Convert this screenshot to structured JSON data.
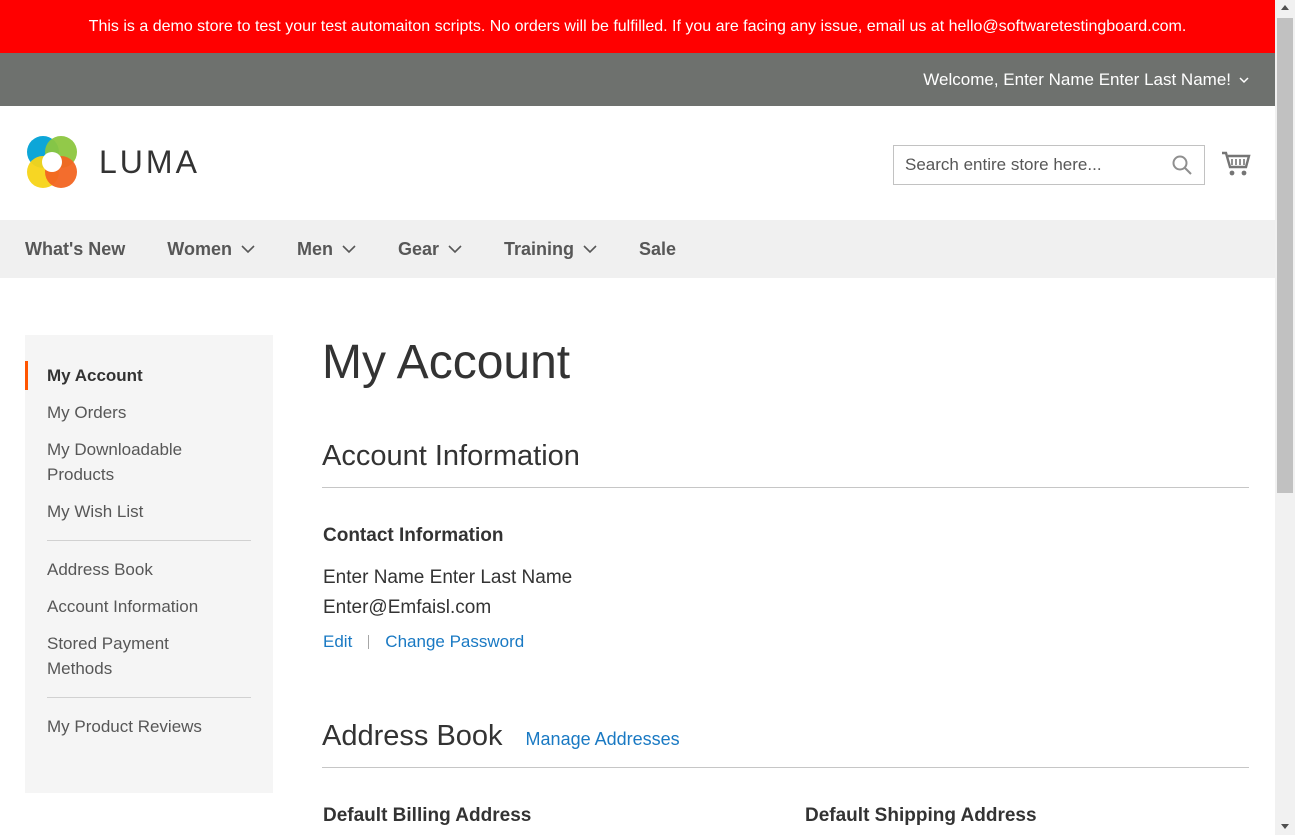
{
  "demo_notice": "This is a demo store to test your test automaiton scripts. No orders will be fulfilled. If you are facing any issue, email us at hello@softwaretestingboard.com.",
  "header": {
    "welcome": "Welcome, Enter Name Enter Last Name!",
    "logo_text": "LUMA",
    "search_placeholder": "Search entire store here...",
    "icons": {
      "search": "search-icon",
      "cart": "cart-icon",
      "welcome_menu": "chevron-down-icon"
    }
  },
  "nav": {
    "items": [
      {
        "label": "What's New",
        "has_dropdown": false
      },
      {
        "label": "Women",
        "has_dropdown": true
      },
      {
        "label": "Men",
        "has_dropdown": true
      },
      {
        "label": "Gear",
        "has_dropdown": true
      },
      {
        "label": "Training",
        "has_dropdown": true
      },
      {
        "label": "Sale",
        "has_dropdown": false
      }
    ]
  },
  "sidebar": {
    "items": [
      {
        "label": "My Account",
        "active": true
      },
      {
        "label": "My Orders"
      },
      {
        "label": "My Downloadable Products"
      },
      {
        "label": "My Wish List"
      },
      {
        "label": "Address Book"
      },
      {
        "label": "Account Information"
      },
      {
        "label": "Stored Payment Methods"
      },
      {
        "label": "My Product Reviews"
      }
    ]
  },
  "main": {
    "title": "My Account",
    "account_info": {
      "heading": "Account Information",
      "contact_title": "Contact Information",
      "name": "Enter Name Enter Last Name",
      "email": "Enter@Emfaisl.com",
      "edit_label": "Edit",
      "change_password_label": "Change Password"
    },
    "address_book": {
      "heading": "Address Book",
      "manage_label": "Manage Addresses",
      "billing_title": "Default Billing Address",
      "shipping_title": "Default Shipping Address"
    }
  },
  "colors": {
    "demo_bar": "#ff0000",
    "welcome_bar": "#6e716e",
    "nav_bg": "#f0f0f0",
    "link": "#1979c3",
    "active_marker": "#ff5501"
  }
}
